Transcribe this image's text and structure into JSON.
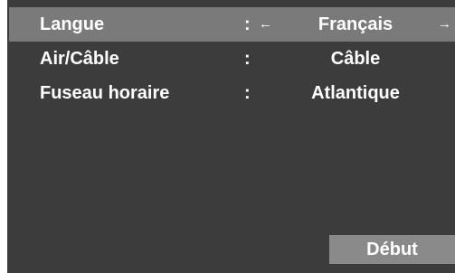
{
  "settings": {
    "rows": [
      {
        "label": "Langue",
        "colon": ":",
        "value": "Français",
        "left_icon": "arrow-left-icon",
        "right_icon": "arrow-right-icon"
      },
      {
        "label": "Air/Câble",
        "colon": ":",
        "value": "Câble"
      },
      {
        "label": "Fuseau horaire",
        "colon": ":",
        "value": "Atlantique"
      }
    ]
  },
  "footer": {
    "start_label": "Début"
  },
  "colors": {
    "background": "#3c3c3c",
    "selected_row": "#7a7a7a",
    "button": "#8a8a8a",
    "text": "#ffffff"
  }
}
